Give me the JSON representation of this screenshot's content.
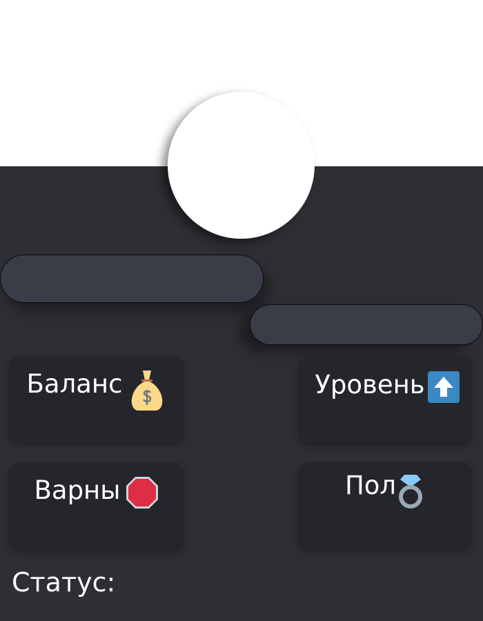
{
  "profile": {
    "avatar_color": "#ffffff"
  },
  "cards": [
    {
      "label": "Баланс",
      "icon": "money-bag-icon"
    },
    {
      "label": "Уровень",
      "icon": "up-arrow-icon"
    },
    {
      "label": "Варны",
      "icon": "stop-sign-icon"
    },
    {
      "label": "Пол",
      "icon": "ring-icon"
    }
  ],
  "status": {
    "label": "Статус:"
  },
  "colors": {
    "background": "#2e2f34",
    "card": "#25262b",
    "pill": "#3a3d47",
    "accent_blue": "#3b88c3",
    "stop_red": "#dd2e44"
  }
}
